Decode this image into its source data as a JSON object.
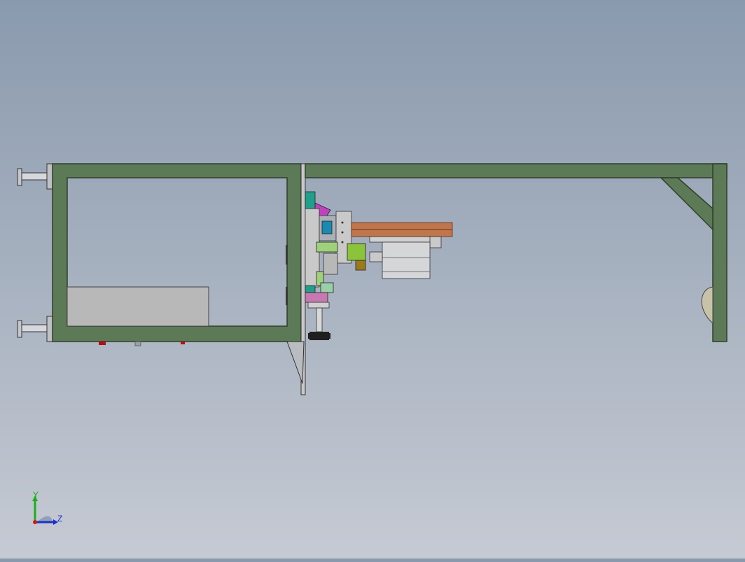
{
  "viewport": {
    "colors": {
      "frame": "#5b7a55",
      "frame_edge": "#2f3f2c",
      "panel": "#b8b8b8",
      "steel": "#c9c9c9",
      "wood": "#c0764a",
      "magenta": "#c040c0",
      "teal": "#1fa08a",
      "lime": "#8bc43a",
      "olive": "#9a7a1a",
      "pink": "#c878b0",
      "red_indicator": "#b01010"
    }
  },
  "triad": {
    "y_label": "Y",
    "z_label": "Z",
    "y_color": "#19b019",
    "z_color": "#1a2fd0",
    "origin_color": "#d01a1a"
  }
}
